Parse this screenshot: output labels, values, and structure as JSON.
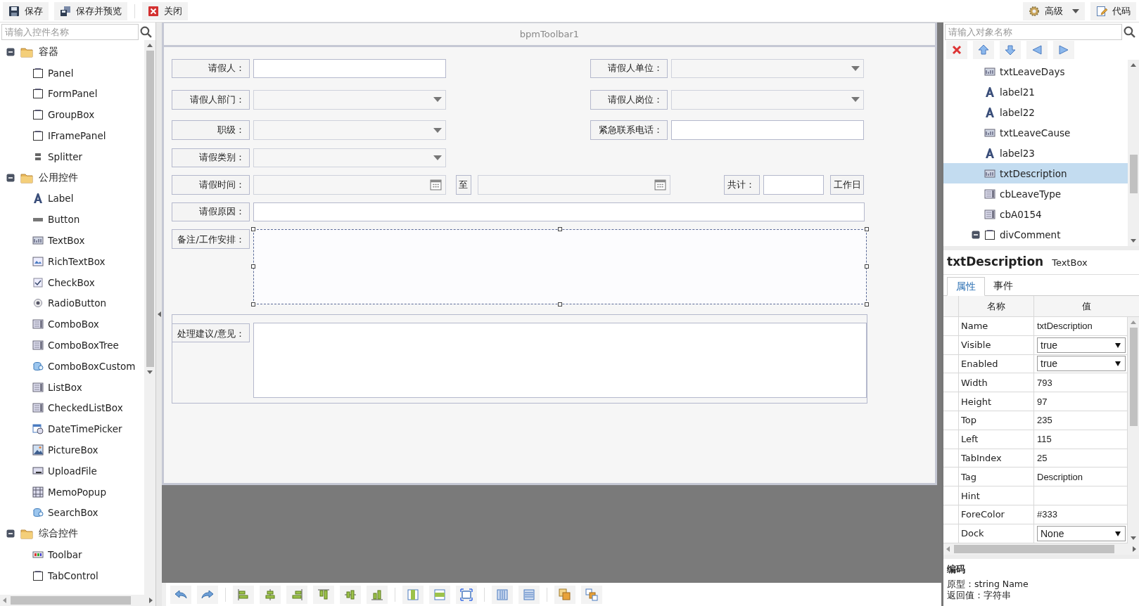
{
  "toolbar": {
    "left_buttons": [
      {
        "kind": "save",
        "label": "保存"
      },
      {
        "kind": "save-preview",
        "label": "保存并预览"
      },
      {
        "kind": "close",
        "label": "关闭"
      }
    ],
    "right_buttons": [
      {
        "kind": "advanced",
        "label": "高级",
        "dropdown": true
      },
      {
        "kind": "code",
        "label": "代码",
        "dropdown": false
      }
    ]
  },
  "controls_panel": {
    "search_placeholder": "请输入控件名称",
    "groups": [
      {
        "label": "容器",
        "expanded": true,
        "children": [
          {
            "label": "Panel",
            "kind": "container"
          },
          {
            "label": "FormPanel",
            "kind": "container"
          },
          {
            "label": "GroupBox",
            "kind": "container"
          },
          {
            "label": "IFramePanel",
            "kind": "container"
          },
          {
            "label": "Splitter",
            "kind": "splitter"
          }
        ]
      },
      {
        "label": "公用控件",
        "expanded": true,
        "children": [
          {
            "label": "Label",
            "kind": "label"
          },
          {
            "label": "Button",
            "kind": "button"
          },
          {
            "label": "TextBox",
            "kind": "textbox"
          },
          {
            "label": "RichTextBox",
            "kind": "richtext"
          },
          {
            "label": "CheckBox",
            "kind": "checkbox"
          },
          {
            "label": "RadioButton",
            "kind": "radio"
          },
          {
            "label": "ComboBox",
            "kind": "combo"
          },
          {
            "label": "ComboBoxTree",
            "kind": "combo"
          },
          {
            "label": "ComboBoxCustom",
            "kind": "custom"
          },
          {
            "label": "ListBox",
            "kind": "list"
          },
          {
            "label": "CheckedListBox",
            "kind": "list"
          },
          {
            "label": "DateTimePicker",
            "kind": "datetime"
          },
          {
            "label": "PictureBox",
            "kind": "picture"
          },
          {
            "label": "UploadFile",
            "kind": "upload"
          },
          {
            "label": "MemoPopup",
            "kind": "memo"
          },
          {
            "label": "SearchBox",
            "kind": "custom"
          }
        ]
      },
      {
        "label": "综合控件",
        "expanded": true,
        "children": [
          {
            "label": "Toolbar",
            "kind": "toolbar"
          },
          {
            "label": "TabControl",
            "kind": "container"
          }
        ]
      }
    ]
  },
  "form": {
    "title": "bpmToolbar1",
    "controls": [
      {
        "kind": "label",
        "text": "请假人：",
        "selected": false
      },
      {
        "kind": "text",
        "selected": false
      },
      {
        "kind": "label",
        "text": "请假人单位：",
        "selected": false
      },
      {
        "kind": "combo",
        "selected": false
      },
      {
        "kind": "label",
        "text": "请假人部门：",
        "selected": false
      },
      {
        "kind": "combo",
        "selected": false
      },
      {
        "kind": "label",
        "text": "请假人岗位：",
        "selected": false
      },
      {
        "kind": "combo",
        "selected": false
      },
      {
        "kind": "label",
        "text": "职级：",
        "selected": false
      },
      {
        "kind": "combo",
        "selected": false
      },
      {
        "kind": "label",
        "text": "紧急联系电话：",
        "selected": false
      },
      {
        "kind": "text",
        "selected": false
      },
      {
        "kind": "label",
        "text": "请假类别：",
        "selected": false
      },
      {
        "kind": "combo",
        "selected": false
      },
      {
        "kind": "label",
        "text": "请假时间：",
        "selected": false
      },
      {
        "kind": "date",
        "selected": false
      },
      {
        "kind": "label",
        "text": "至",
        "selected": false
      },
      {
        "kind": "date",
        "selected": false
      },
      {
        "kind": "label",
        "text": "共计：",
        "selected": false
      },
      {
        "kind": "text",
        "selected": false
      },
      {
        "kind": "label",
        "text": "工作日",
        "selected": false
      },
      {
        "kind": "label",
        "text": "请假原因：",
        "selected": false
      },
      {
        "kind": "text",
        "selected": false
      },
      {
        "kind": "label",
        "text": "备注/工作安排：",
        "selected": false
      },
      {
        "kind": "textarea",
        "selected": true
      },
      {
        "kind": "group",
        "selected": false
      },
      {
        "kind": "label",
        "text": "处理建议/意见：",
        "selected": false
      },
      {
        "kind": "textarea",
        "selected": false
      }
    ]
  },
  "object_panel": {
    "search_placeholder": "请输入对象名称",
    "tree": [
      {
        "label": "txtLeaveDays",
        "kind": "textbox",
        "selected": false
      },
      {
        "label": "label21",
        "kind": "label",
        "selected": false
      },
      {
        "label": "label22",
        "kind": "label",
        "selected": false
      },
      {
        "label": "txtLeaveCause",
        "kind": "textbox",
        "selected": false
      },
      {
        "label": "label23",
        "kind": "label",
        "selected": false
      },
      {
        "label": "txtDescription",
        "kind": "textbox",
        "selected": true
      },
      {
        "label": "cbLeaveType",
        "kind": "combo",
        "selected": false
      },
      {
        "label": "cbA0154",
        "kind": "combo",
        "selected": false
      },
      {
        "label": "divComment",
        "kind": "container",
        "selected": false,
        "expanded": true
      }
    ],
    "object_name": "txtDescription",
    "object_type": "TextBox",
    "tabs": [
      {
        "label": "属性",
        "selected": true
      },
      {
        "label": "事件",
        "selected": false
      }
    ],
    "columns": [
      "名称",
      "值"
    ],
    "properties": [
      {
        "name": "Name",
        "value": "txtDescription",
        "kind": "text"
      },
      {
        "name": "Visible",
        "value": "true",
        "kind": "select"
      },
      {
        "name": "Enabled",
        "value": "true",
        "kind": "select"
      },
      {
        "name": "Width",
        "value": "793",
        "kind": "text"
      },
      {
        "name": "Height",
        "value": "97",
        "kind": "text"
      },
      {
        "name": "Top",
        "value": "235",
        "kind": "text"
      },
      {
        "name": "Left",
        "value": "115",
        "kind": "text"
      },
      {
        "name": "TabIndex",
        "value": "25",
        "kind": "text"
      },
      {
        "name": "Tag",
        "value": "Description",
        "kind": "text"
      },
      {
        "name": "Hint",
        "kind": "text"
      },
      {
        "name": "ForeColor",
        "value": "#333",
        "kind": "text"
      },
      {
        "name": "Dock",
        "value": "None",
        "kind": "select"
      }
    ],
    "description": {
      "title": "编码",
      "lines": [
        "原型：string Name",
        "返回值：字符串"
      ]
    }
  }
}
